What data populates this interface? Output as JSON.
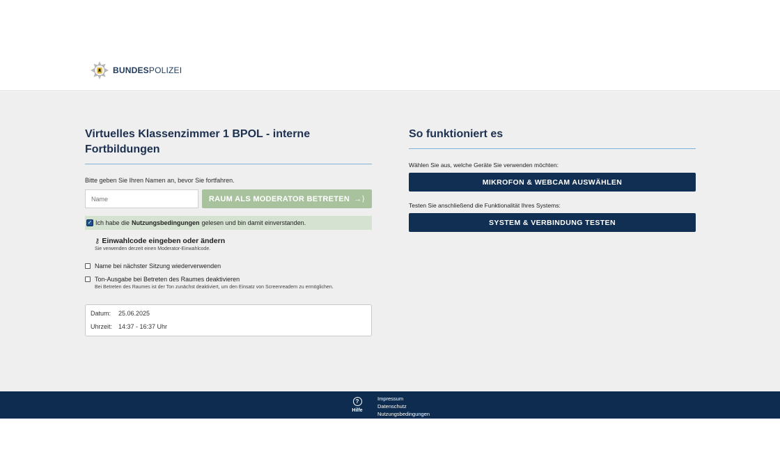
{
  "header": {
    "logo_text_bold": "BUNDES",
    "logo_text_rest": "POLIZEI",
    "logo_icon": "eagle-star-emblem"
  },
  "left": {
    "title": "Virtuelles Klassenzimmer 1 BPOL - interne Fortbildungen",
    "name_prompt": "Bitte geben Sie Ihren Namen an, bevor Sie fortfahren.",
    "name_placeholder": "Name",
    "moderator_button": "RAUM ALS MODERATOR BETRETEN",
    "terms": {
      "prefix": "Ich habe die",
      "link": "Nutzungsbedingungen",
      "suffix": "gelesen und bin damit einverstanden.",
      "checked": true
    },
    "dial_in": {
      "heading": "Einwahlcode eingeben oder ändern",
      "sub": "Sie verwenden derzeit einen Moderator-Einwahlcode."
    },
    "options": [
      {
        "label": "Name bei nächster Sitzung wiederverwenden",
        "sub": ""
      },
      {
        "label": "Ton-Ausgabe bei Betreten des Raumes deaktivieren",
        "sub": "Bei Betreten des Raumes ist der Ton zunächst deaktiviert, um den Einsatz von Screenreadern zu ermöglichen."
      }
    ],
    "schedule": {
      "date_label": "Datum:",
      "date_value": "25.06.2025",
      "time_label": "Uhrzeit:",
      "time_value": "14:37 - 16:37 Uhr"
    }
  },
  "right": {
    "title": "So funktioniert es",
    "devices_text": "Wählen Sie aus, welche Geräte Sie verwenden möchten:",
    "devices_button": "MIKROFON & WEBCAM AUSWÄHLEN",
    "test_text": "Testen Sie anschließend die Funktionalität Ihres Systems:",
    "test_button": "SYSTEM & VERBINDUNG TESTEN"
  },
  "footer": {
    "help_icon": "?",
    "help_label": "Hilfe",
    "links": [
      "Impressum",
      "Datenschutz",
      "Nutzungsbedingungen"
    ]
  },
  "colors": {
    "primary_dark": "#112f52",
    "footer_bg": "#0d2c4f",
    "moderator_button_bg": "#a9c29e",
    "terms_row_bg": "#d5e2d1",
    "rule": "#7fb2d8",
    "page_bg": "#efefef"
  }
}
